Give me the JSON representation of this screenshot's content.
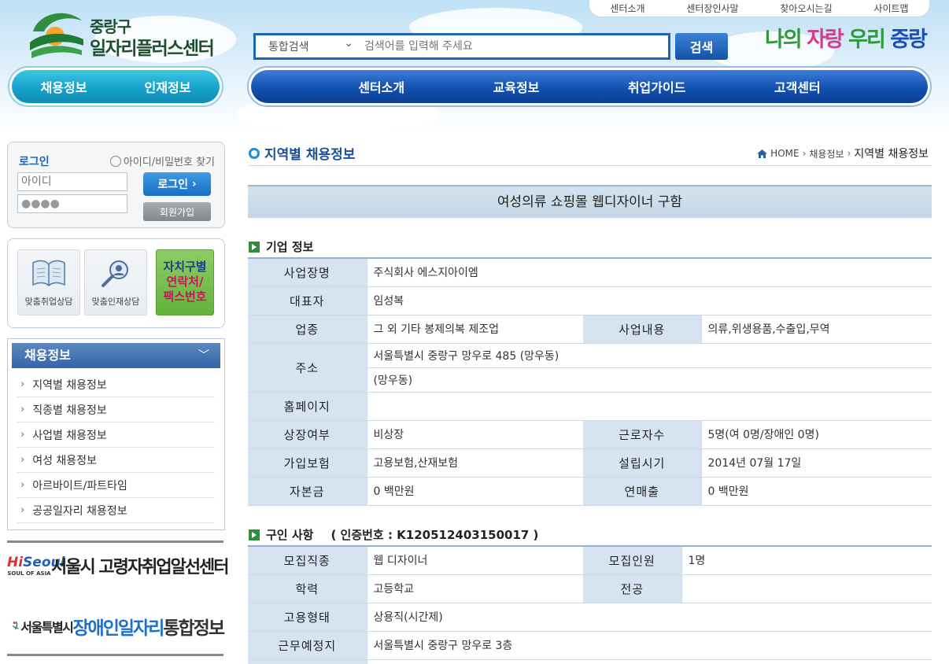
{
  "util_links": [
    "센터소개",
    "센터장인사말",
    "찾아오시는길",
    "사이트맵"
  ],
  "logo": {
    "line1": "중랑구",
    "line2": "일자리플러스센터",
    "icon": "leaf-sun-logo-icon"
  },
  "search": {
    "category": "통합검색",
    "placeholder": "검색어를 입력해 주세요",
    "button": "검색"
  },
  "slogan": {
    "p1": "나의 ",
    "p2": "자랑",
    "p3": " 우리 ",
    "p4": "중랑"
  },
  "nav_left": [
    "채용정보",
    "인재정보"
  ],
  "nav_main": [
    "센터소개",
    "교육정보",
    "취업가이드",
    "고객센터"
  ],
  "login": {
    "title": "로그인",
    "find": "아이디/비밀번호 찾기",
    "id_placeholder": "아이디",
    "pw_value": "●●●●",
    "login_button": "로그인",
    "join_button": "회원가입"
  },
  "quick": {
    "card1": "맞춤취업상담",
    "card2": "맞춤인재상담",
    "green_line1": "자치구별",
    "green_line2": "연락처/",
    "green_line3": "팩스번호"
  },
  "side_menu": {
    "title": "채용정보",
    "items": [
      "지역별 채용정보",
      "직종별 채용정보",
      "사업별 채용정보",
      "여성 채용정보",
      "아르바이트/파트타임",
      "공공일자리 채용정보"
    ]
  },
  "banner1": {
    "hi": "Hi",
    "seoul": "Seoul",
    "sub": "SOUL OF ASIA",
    "text": "서울시 고령자취업알선센터"
  },
  "banner2": {
    "t1": "서울특별시",
    "t2": "장애인일자리",
    "t3": "통합정보"
  },
  "page": {
    "title": "지역별 채용정보",
    "breadcrumb": [
      "HOME",
      "채용정보",
      "지역별 채용정보"
    ],
    "job_title": "여성의류 쇼핑몰 웹디자이너 구함"
  },
  "company": {
    "section_title": "기업 정보",
    "labels": {
      "name": "사업장명",
      "ceo": "대표자",
      "industry": "업종",
      "business": "사업내용",
      "address": "주소",
      "homepage": "홈페이지",
      "listed": "상장여부",
      "employees": "근로자수",
      "insurance": "가입보험",
      "founded": "설립시기",
      "capital": "자본금",
      "sales": "연매출"
    },
    "values": {
      "name": "주식회사 에스지아이엠",
      "ceo": "임성복",
      "industry": "그 외 기타 봉제의복 제조업",
      "business": "의류,위생용품,수출입,무역",
      "address1": "서울특별시 중랑구 망우로 485 (망우동)",
      "address2": "(망우동)",
      "homepage": "",
      "listed": "비상장",
      "employees": "5명(여 0명/장애인 0명)",
      "insurance": "고용보험,산재보험",
      "founded": "2014년 07월 17일",
      "capital": "0 백만원",
      "sales": "0 백만원"
    }
  },
  "recruit": {
    "section_title": "구인 사항",
    "cert": "( 인증번호 : K120512403150017 )",
    "labels": {
      "job": "모집직종",
      "count": "모집인원",
      "education": "학력",
      "major": "전공",
      "type": "고용형태",
      "location": "근무예정지"
    },
    "values": {
      "job": "웹 디자이너",
      "count": "1명",
      "education": "고등학교",
      "major": "",
      "type": "상용직(시간제)",
      "location": "서울특별시 중랑구 망우로 3층"
    }
  },
  "colors": {
    "primary_blue": "#1250b1",
    "cyan": "#17a2cb",
    "green": "#2f8c3a",
    "header_cell": "#d6e4f1"
  }
}
